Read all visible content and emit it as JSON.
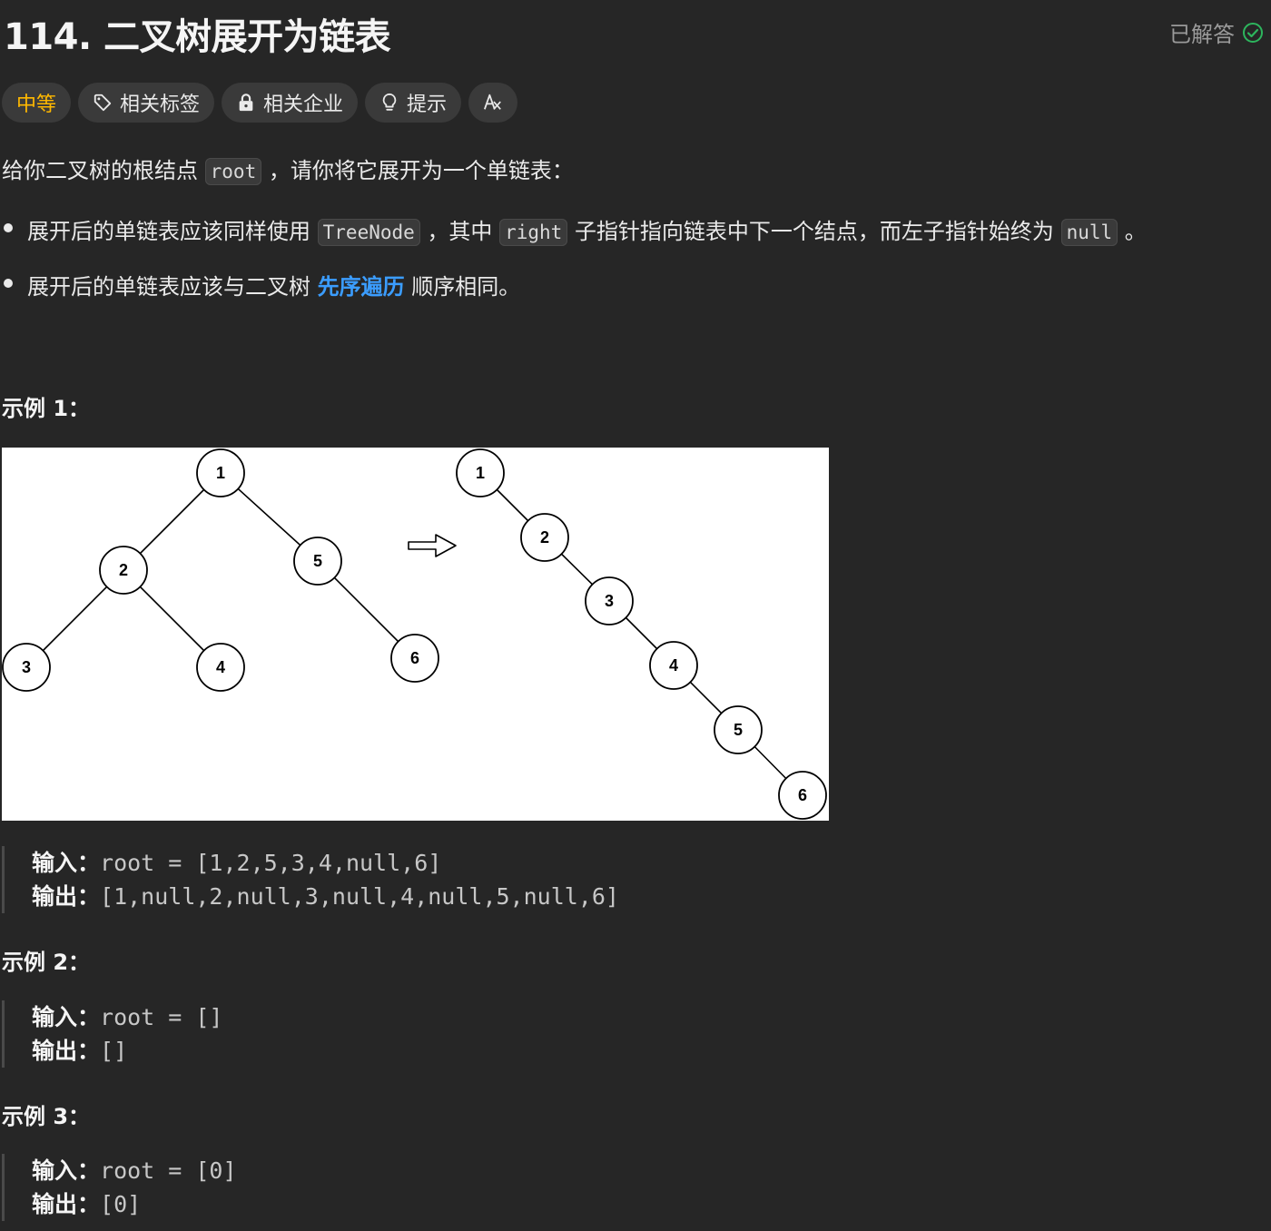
{
  "title": "114. 二叉树展开为链表",
  "status": "已解答",
  "tags": {
    "difficulty": "中等",
    "related_tags": "相关标签",
    "companies": "相关企业",
    "hint": "提示"
  },
  "intro": {
    "pre": "给你二叉树的根结点",
    "code": "root",
    "post": "，请你将它展开为一个单链表："
  },
  "bullet1": {
    "pre": "展开后的单链表应该同样使用",
    "code1": "TreeNode",
    "mid1": "，其中",
    "code2": "right",
    "mid2": "子指针指向链表中下一个结点，而左子指针始终为",
    "code3": "null",
    "post": "。"
  },
  "bullet2": {
    "pre": "展开后的单链表应该与二叉树",
    "link": "先序遍历",
    "post": "顺序相同。"
  },
  "examples": [
    {
      "heading": "示例 1：",
      "input_label": "输入：",
      "input": "root = [1,2,5,3,4,null,6]",
      "output_label": "输出：",
      "output": "[1,null,2,null,3,null,4,null,5,null,6]"
    },
    {
      "heading": "示例 2：",
      "input_label": "输入：",
      "input": "root = []",
      "output_label": "输出：",
      "output": "[]"
    },
    {
      "heading": "示例 3：",
      "input_label": "输入：",
      "input": "root = [0]",
      "output_label": "输出：",
      "output": "[0]"
    }
  ],
  "tree_figure": {
    "left_nodes": [
      "1",
      "2",
      "5",
      "3",
      "4",
      "6"
    ],
    "right_nodes": [
      "1",
      "2",
      "3",
      "4",
      "5",
      "6"
    ]
  },
  "colors": {
    "difficulty": "#ffb800",
    "link": "#3b9dff",
    "solved_check": "#2db55d"
  }
}
